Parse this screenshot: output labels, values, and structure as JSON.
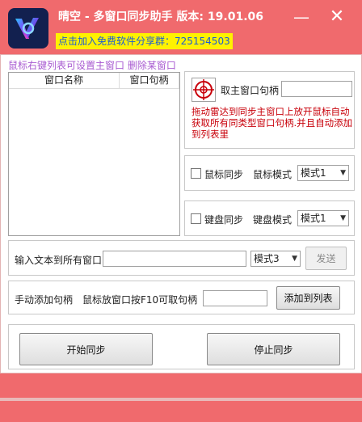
{
  "window": {
    "title": "晴空 - 多窗口同步助手  版本: 19.01.06",
    "promo": "点击加入免费软件分享群：725154503",
    "minimize_glyph": "—",
    "close_glyph": "✕"
  },
  "hint": "鼠标右键列表可设置主窗口  删除某窗口",
  "list": {
    "columns": [
      "窗口名称",
      "窗口句柄"
    ]
  },
  "main_window": {
    "label": "取主窗口句柄",
    "value": "",
    "note": "拖动雷达到同步主窗口上放开鼠标自动获取所有同类型窗口句柄.并且自动添加到列表里"
  },
  "mouse_sync": {
    "checkbox_label": "鼠标同步",
    "checked": false,
    "mode_label": "鼠标模式",
    "mode_value": "模式1"
  },
  "keyboard_sync": {
    "checkbox_label": "键盘同步",
    "checked": false,
    "mode_label": "键盘模式",
    "mode_value": "模式1"
  },
  "text_input": {
    "label": "输入文本到所有窗口",
    "value": "",
    "mode_value": "模式3",
    "send_label": "发送"
  },
  "manual_add": {
    "label": "手动添加句柄",
    "hint": "鼠标放窗口按F10可取句柄",
    "value": "",
    "button_label": "添加到列表"
  },
  "sync": {
    "start_label": "开始同步",
    "stop_label": "停止同步"
  },
  "colors": {
    "accent": "#f06a6d",
    "note_red": "#c8000a",
    "hint_purple": "#a85ad1",
    "banner_bg": "#fff200",
    "banner_text": "#1a5bd6"
  },
  "icons": {
    "app": "app-logo-icon",
    "target": "radar-crosshair-icon",
    "dropdown": "chevron-down-icon"
  }
}
